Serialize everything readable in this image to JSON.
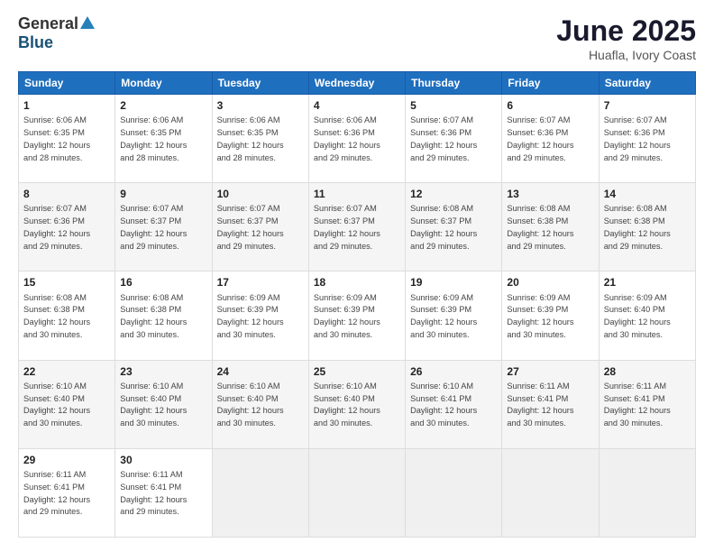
{
  "header": {
    "logo_general": "General",
    "logo_blue": "Blue",
    "title": "June 2025",
    "location": "Huafla, Ivory Coast"
  },
  "days_of_week": [
    "Sunday",
    "Monday",
    "Tuesday",
    "Wednesday",
    "Thursday",
    "Friday",
    "Saturday"
  ],
  "weeks": [
    [
      {
        "day": "1",
        "sunrise": "6:06 AM",
        "sunset": "6:35 PM",
        "daylight": "12 hours and 28 minutes."
      },
      {
        "day": "2",
        "sunrise": "6:06 AM",
        "sunset": "6:35 PM",
        "daylight": "12 hours and 28 minutes."
      },
      {
        "day": "3",
        "sunrise": "6:06 AM",
        "sunset": "6:35 PM",
        "daylight": "12 hours and 28 minutes."
      },
      {
        "day": "4",
        "sunrise": "6:06 AM",
        "sunset": "6:36 PM",
        "daylight": "12 hours and 29 minutes."
      },
      {
        "day": "5",
        "sunrise": "6:07 AM",
        "sunset": "6:36 PM",
        "daylight": "12 hours and 29 minutes."
      },
      {
        "day": "6",
        "sunrise": "6:07 AM",
        "sunset": "6:36 PM",
        "daylight": "12 hours and 29 minutes."
      },
      {
        "day": "7",
        "sunrise": "6:07 AM",
        "sunset": "6:36 PM",
        "daylight": "12 hours and 29 minutes."
      }
    ],
    [
      {
        "day": "8",
        "sunrise": "6:07 AM",
        "sunset": "6:36 PM",
        "daylight": "12 hours and 29 minutes."
      },
      {
        "day": "9",
        "sunrise": "6:07 AM",
        "sunset": "6:37 PM",
        "daylight": "12 hours and 29 minutes."
      },
      {
        "day": "10",
        "sunrise": "6:07 AM",
        "sunset": "6:37 PM",
        "daylight": "12 hours and 29 minutes."
      },
      {
        "day": "11",
        "sunrise": "6:07 AM",
        "sunset": "6:37 PM",
        "daylight": "12 hours and 29 minutes."
      },
      {
        "day": "12",
        "sunrise": "6:08 AM",
        "sunset": "6:37 PM",
        "daylight": "12 hours and 29 minutes."
      },
      {
        "day": "13",
        "sunrise": "6:08 AM",
        "sunset": "6:38 PM",
        "daylight": "12 hours and 29 minutes."
      },
      {
        "day": "14",
        "sunrise": "6:08 AM",
        "sunset": "6:38 PM",
        "daylight": "12 hours and 29 minutes."
      }
    ],
    [
      {
        "day": "15",
        "sunrise": "6:08 AM",
        "sunset": "6:38 PM",
        "daylight": "12 hours and 30 minutes."
      },
      {
        "day": "16",
        "sunrise": "6:08 AM",
        "sunset": "6:38 PM",
        "daylight": "12 hours and 30 minutes."
      },
      {
        "day": "17",
        "sunrise": "6:09 AM",
        "sunset": "6:39 PM",
        "daylight": "12 hours and 30 minutes."
      },
      {
        "day": "18",
        "sunrise": "6:09 AM",
        "sunset": "6:39 PM",
        "daylight": "12 hours and 30 minutes."
      },
      {
        "day": "19",
        "sunrise": "6:09 AM",
        "sunset": "6:39 PM",
        "daylight": "12 hours and 30 minutes."
      },
      {
        "day": "20",
        "sunrise": "6:09 AM",
        "sunset": "6:39 PM",
        "daylight": "12 hours and 30 minutes."
      },
      {
        "day": "21",
        "sunrise": "6:09 AM",
        "sunset": "6:40 PM",
        "daylight": "12 hours and 30 minutes."
      }
    ],
    [
      {
        "day": "22",
        "sunrise": "6:10 AM",
        "sunset": "6:40 PM",
        "daylight": "12 hours and 30 minutes."
      },
      {
        "day": "23",
        "sunrise": "6:10 AM",
        "sunset": "6:40 PM",
        "daylight": "12 hours and 30 minutes."
      },
      {
        "day": "24",
        "sunrise": "6:10 AM",
        "sunset": "6:40 PM",
        "daylight": "12 hours and 30 minutes."
      },
      {
        "day": "25",
        "sunrise": "6:10 AM",
        "sunset": "6:40 PM",
        "daylight": "12 hours and 30 minutes."
      },
      {
        "day": "26",
        "sunrise": "6:10 AM",
        "sunset": "6:41 PM",
        "daylight": "12 hours and 30 minutes."
      },
      {
        "day": "27",
        "sunrise": "6:11 AM",
        "sunset": "6:41 PM",
        "daylight": "12 hours and 30 minutes."
      },
      {
        "day": "28",
        "sunrise": "6:11 AM",
        "sunset": "6:41 PM",
        "daylight": "12 hours and 30 minutes."
      }
    ],
    [
      {
        "day": "29",
        "sunrise": "6:11 AM",
        "sunset": "6:41 PM",
        "daylight": "12 hours and 29 minutes."
      },
      {
        "day": "30",
        "sunrise": "6:11 AM",
        "sunset": "6:41 PM",
        "daylight": "12 hours and 29 minutes."
      },
      null,
      null,
      null,
      null,
      null
    ]
  ]
}
